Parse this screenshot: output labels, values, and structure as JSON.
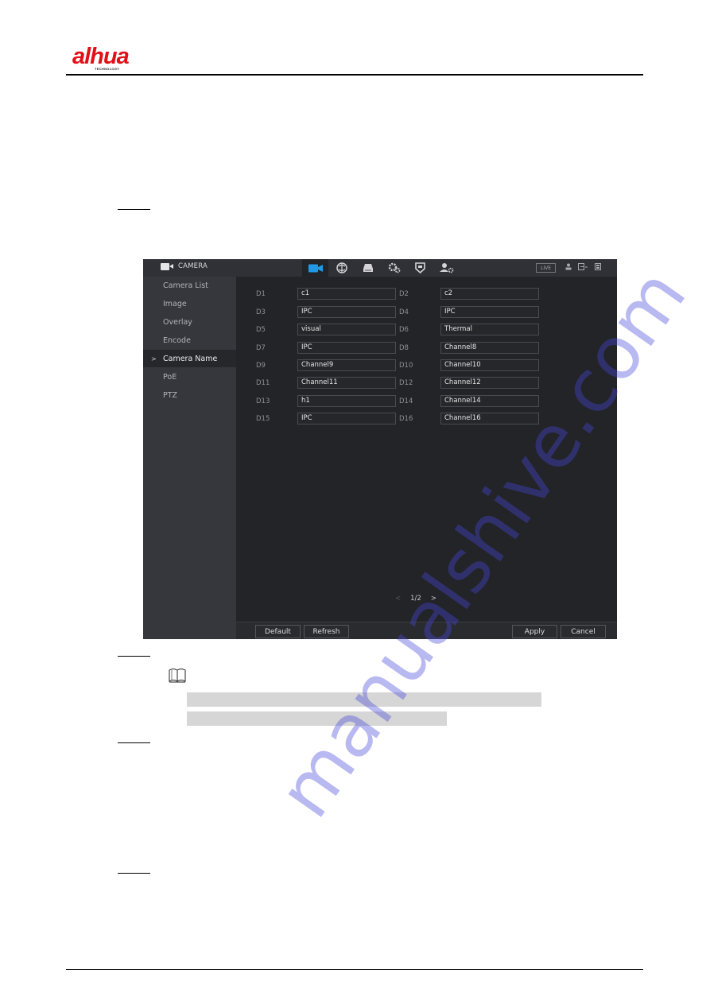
{
  "header": {
    "brand": "alhua",
    "brand_sub": "TECHNOLOGY"
  },
  "ui": {
    "module_title": "CAMERA",
    "nav_icons": [
      {
        "name": "camera-icon",
        "active": true
      },
      {
        "name": "network-icon",
        "active": false
      },
      {
        "name": "storage-icon",
        "active": false
      },
      {
        "name": "system-settings-icon",
        "active": false
      },
      {
        "name": "security-shield-icon",
        "active": false
      },
      {
        "name": "account-icon",
        "active": false
      }
    ],
    "live_label": "LIVE",
    "top_right_icons": [
      "user-icon",
      "logout-icon",
      "fullscreen-icon"
    ],
    "sidebar": {
      "items": [
        {
          "label": "Camera List",
          "active": false
        },
        {
          "label": "Image",
          "active": false
        },
        {
          "label": "Overlay",
          "active": false
        },
        {
          "label": "Encode",
          "active": false
        },
        {
          "label": "Camera Name",
          "active": true
        },
        {
          "label": "PoE",
          "active": false
        },
        {
          "label": "PTZ",
          "active": false
        }
      ],
      "active_marker": ">"
    },
    "channels": [
      {
        "label": "D1",
        "value": "c1"
      },
      {
        "label": "D2",
        "value": "c2"
      },
      {
        "label": "D3",
        "value": "IPC"
      },
      {
        "label": "D4",
        "value": "IPC"
      },
      {
        "label": "D5",
        "value": "visual"
      },
      {
        "label": "D6",
        "value": "Thermal"
      },
      {
        "label": "D7",
        "value": "IPC"
      },
      {
        "label": "D8",
        "value": "Channel8"
      },
      {
        "label": "D9",
        "value": "Channel9"
      },
      {
        "label": "D10",
        "value": "Channel10"
      },
      {
        "label": "D11",
        "value": "Channel11"
      },
      {
        "label": "D12",
        "value": "Channel12"
      },
      {
        "label": "D13",
        "value": "h1"
      },
      {
        "label": "D14",
        "value": "Channel14"
      },
      {
        "label": "D15",
        "value": "IPC"
      },
      {
        "label": "D16",
        "value": "Channel16"
      }
    ],
    "pager": {
      "prev": "<",
      "page": "1/2",
      "next": ">"
    },
    "buttons": {
      "default": "Default",
      "refresh": "Refresh",
      "apply": "Apply",
      "cancel": "Cancel"
    }
  },
  "watermark": "manualshive.com"
}
